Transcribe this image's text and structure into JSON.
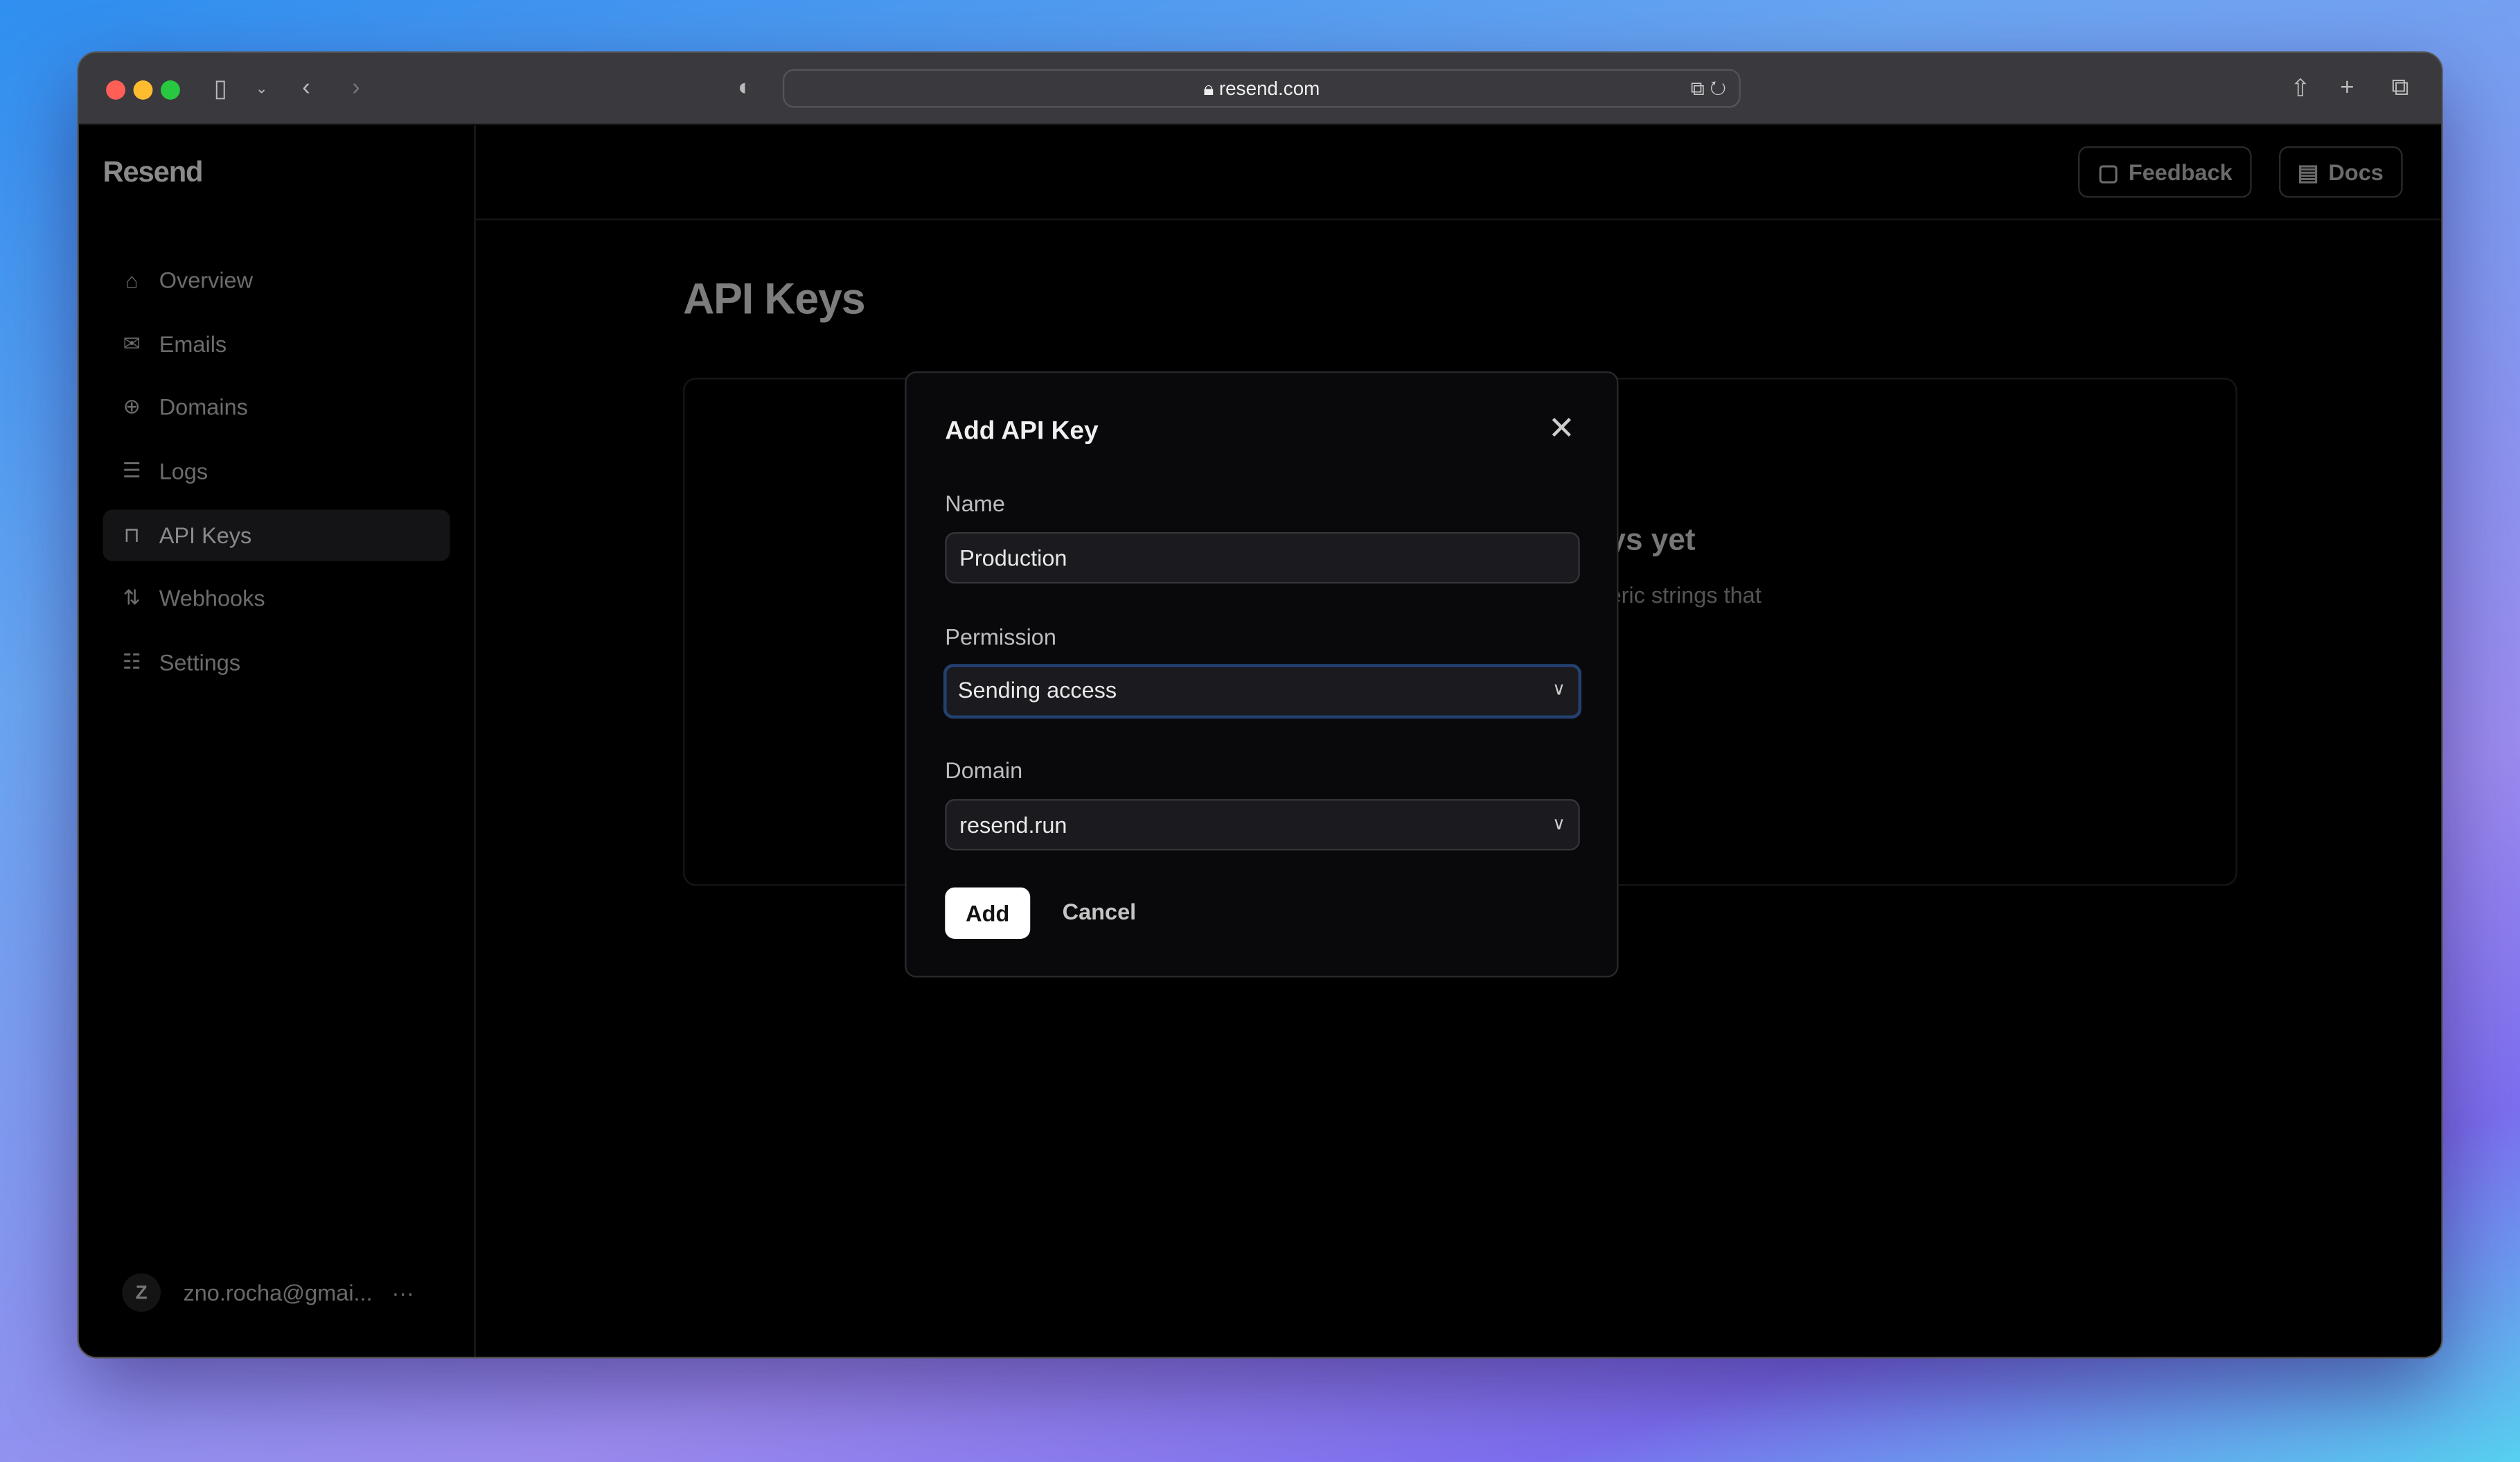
{
  "browser": {
    "url": "resend.com",
    "colors": {
      "close": "#ff5f57",
      "minimize": "#febc2e",
      "zoom": "#28c840"
    }
  },
  "sidebar": {
    "logo": "Resend",
    "items": [
      {
        "label": "Overview",
        "icon": "home-icon"
      },
      {
        "label": "Emails",
        "icon": "mail-icon"
      },
      {
        "label": "Domains",
        "icon": "globe-icon"
      },
      {
        "label": "Logs",
        "icon": "logs-icon"
      },
      {
        "label": "API Keys",
        "icon": "lock-icon",
        "active": true
      },
      {
        "label": "Webhooks",
        "icon": "webhook-icon"
      },
      {
        "label": "Settings",
        "icon": "sliders-icon"
      }
    ],
    "user": {
      "initial": "Z",
      "email": "zno.rocha@gmai...",
      "more": "···"
    }
  },
  "header": {
    "feedback": "Feedback",
    "docs": "Docs"
  },
  "page": {
    "title": "API Keys",
    "empty_title": "ys yet",
    "empty_text": "eric strings that"
  },
  "modal": {
    "title": "Add API Key",
    "name_label": "Name",
    "name_value": "Production",
    "permission_label": "Permission",
    "permission_value": "Sending access",
    "domain_label": "Domain",
    "domain_value": "resend.run",
    "add": "Add",
    "cancel": "Cancel",
    "focus_color": "#23406f"
  }
}
